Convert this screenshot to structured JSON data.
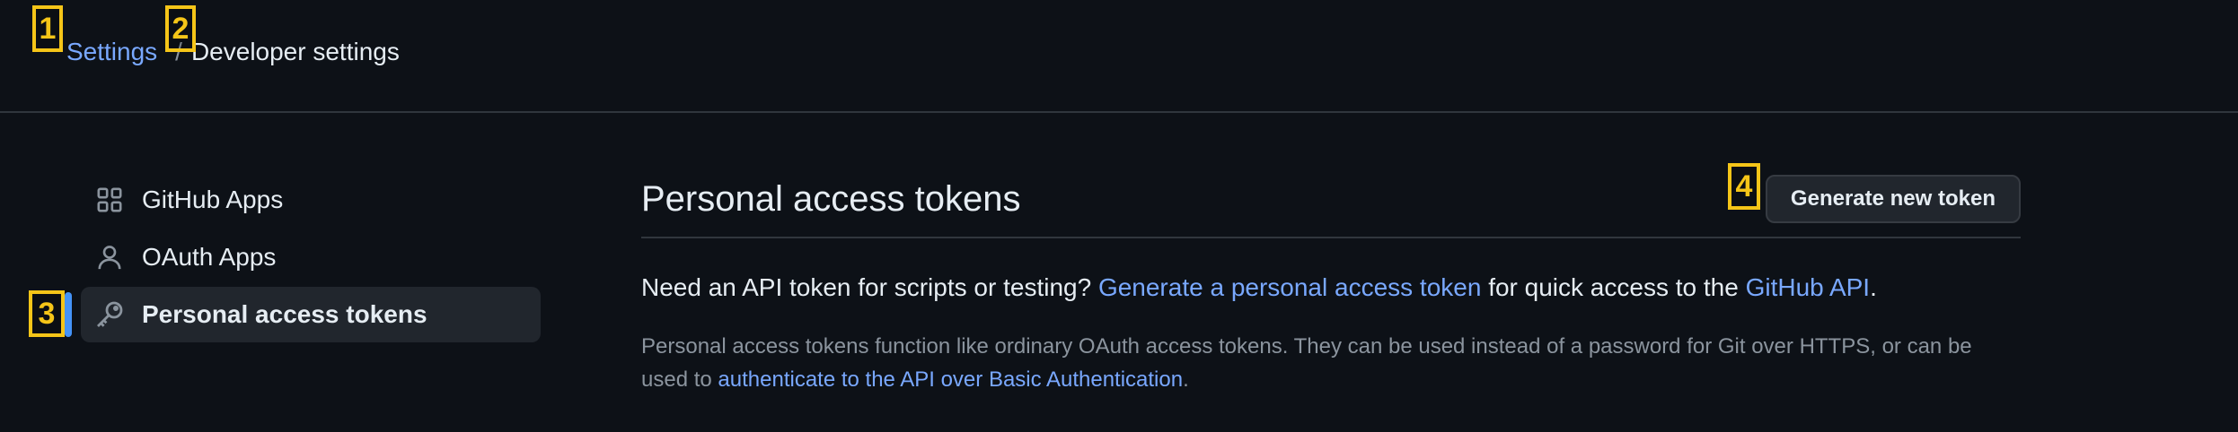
{
  "breadcrumb": {
    "settings": "Settings",
    "separator": "/",
    "current": "Developer settings"
  },
  "sidebar": {
    "items": [
      {
        "label": "GitHub Apps",
        "icon": "apps-grid-icon"
      },
      {
        "label": "OAuth Apps",
        "icon": "person-icon"
      },
      {
        "label": "Personal access tokens",
        "icon": "key-icon",
        "active": true
      }
    ]
  },
  "main": {
    "title": "Personal access tokens",
    "generate_button": "Generate new token",
    "lead": {
      "text1": "Need an API token for scripts or testing? ",
      "link1": "Generate a personal access token",
      "text2": " for quick access to the ",
      "link2": "GitHub API",
      "text3": "."
    },
    "description": {
      "text1": "Personal access tokens function like ordinary OAuth access tokens. They can be used instead of a password for Git over HTTPS, or can be used to ",
      "link": "authenticate to the API over Basic Authentication",
      "text2": "."
    }
  },
  "markers": [
    "1",
    "2",
    "3",
    "4"
  ],
  "colors": {
    "background": "#0d1117",
    "link": "#79a8ff",
    "marker": "#f5c518",
    "active_indicator": "#4493f8",
    "border": "#30363d"
  }
}
